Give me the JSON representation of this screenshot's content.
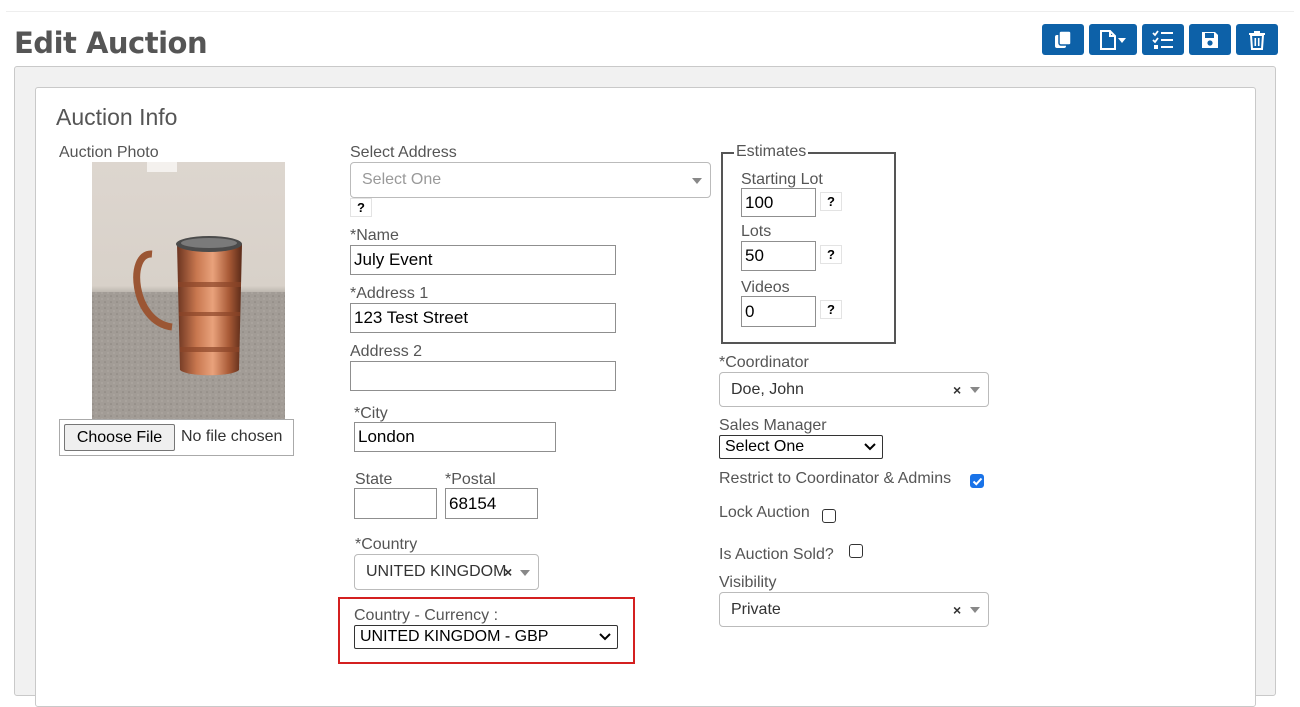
{
  "page": {
    "title": "Edit Auction",
    "toolbar": {
      "buttons": [
        {
          "icon": "copy-icon"
        },
        {
          "icon": "new-document-dropdown-icon"
        },
        {
          "icon": "checklist-icon"
        },
        {
          "icon": "save-icon"
        },
        {
          "icon": "trash-icon"
        }
      ]
    }
  },
  "auction_info": {
    "title": "Auction Info",
    "photo": {
      "label": "Auction Photo",
      "choose_file_label": "Choose File",
      "no_file_text": "No file chosen"
    },
    "select_address": {
      "label": "Select Address",
      "placeholder": "Select One",
      "help": "?"
    },
    "name": {
      "label": "*Name",
      "value": "July Event"
    },
    "address1": {
      "label": "*Address 1",
      "value": "123 Test Street"
    },
    "address2": {
      "label": "Address 2",
      "value": ""
    },
    "city": {
      "label": "*City",
      "value": "London"
    },
    "state": {
      "label": "State",
      "value": ""
    },
    "postal": {
      "label": "*Postal",
      "value": "68154"
    },
    "country": {
      "label": "*Country",
      "value": "UNITED KINGDOM",
      "clear": "×"
    },
    "country_currency": {
      "label": "Country - Currency :",
      "value": "UNITED KINGDOM - GBP"
    },
    "estimates": {
      "legend": "Estimates",
      "starting_lot": {
        "label": "Starting Lot",
        "value": "100",
        "help": "?"
      },
      "lots": {
        "label": "Lots",
        "value": "50",
        "help": "?"
      },
      "videos": {
        "label": "Videos",
        "value": "0",
        "help": "?"
      }
    },
    "coordinator": {
      "label": "*Coordinator",
      "value": "Doe, John",
      "clear": "×"
    },
    "sales_manager": {
      "label": "Sales Manager",
      "value": "Select One"
    },
    "restrict": {
      "label": "Restrict to Coordinator & Admins",
      "checked": true
    },
    "lock_auction": {
      "label": "Lock Auction",
      "checked": false
    },
    "is_sold": {
      "label": "Is Auction Sold?",
      "checked": false
    },
    "visibility": {
      "label": "Visibility",
      "value": "Private",
      "clear": "×"
    }
  },
  "colors": {
    "toolbar_button": "#0d61a8",
    "highlight": "#d42020",
    "checkbox_checked": "#1a73e8"
  }
}
